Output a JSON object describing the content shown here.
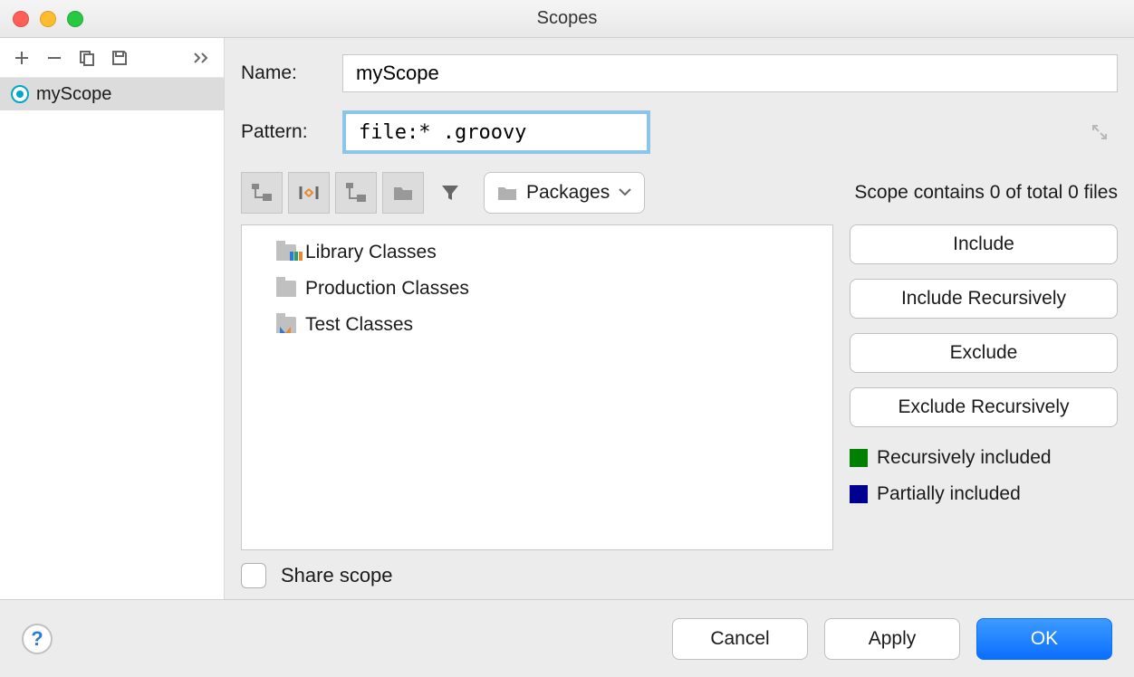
{
  "window": {
    "title": "Scopes"
  },
  "sidebar": {
    "toolbar": {
      "add": "add-scope",
      "remove": "remove-scope",
      "copy": "copy-scope",
      "save": "save-as",
      "overflow": "overflow"
    },
    "items": [
      {
        "label": "myScope"
      }
    ]
  },
  "form": {
    "name_label": "Name:",
    "name_value": "myScope",
    "pattern_label": "Pattern:",
    "pattern_value": "file:* .groovy"
  },
  "tree_toolbar": {
    "button_1": "tree-view",
    "button_2": "scroll-to-source",
    "button_3": "up",
    "button_4": "folder",
    "button_5": "filter",
    "dropdown_label": "Packages"
  },
  "status": "Scope contains 0 of total 0 files",
  "tree": [
    {
      "label": "Library Classes",
      "icon": "library"
    },
    {
      "label": "Production Classes",
      "icon": "production"
    },
    {
      "label": "Test Classes",
      "icon": "test"
    }
  ],
  "actions": {
    "include": "Include",
    "include_rec": "Include Recursively",
    "exclude": "Exclude",
    "exclude_rec": "Exclude Recursively"
  },
  "legend": {
    "recursively": "Recursively included",
    "partially": "Partially included"
  },
  "share": {
    "label": "Share scope",
    "checked": false
  },
  "buttons": {
    "cancel": "Cancel",
    "apply": "Apply",
    "ok": "OK"
  },
  "colors": {
    "focus_ring": "#8ec4e8",
    "primary": "#0a6eff",
    "legend_green": "#008000",
    "legend_blue": "#000090"
  }
}
